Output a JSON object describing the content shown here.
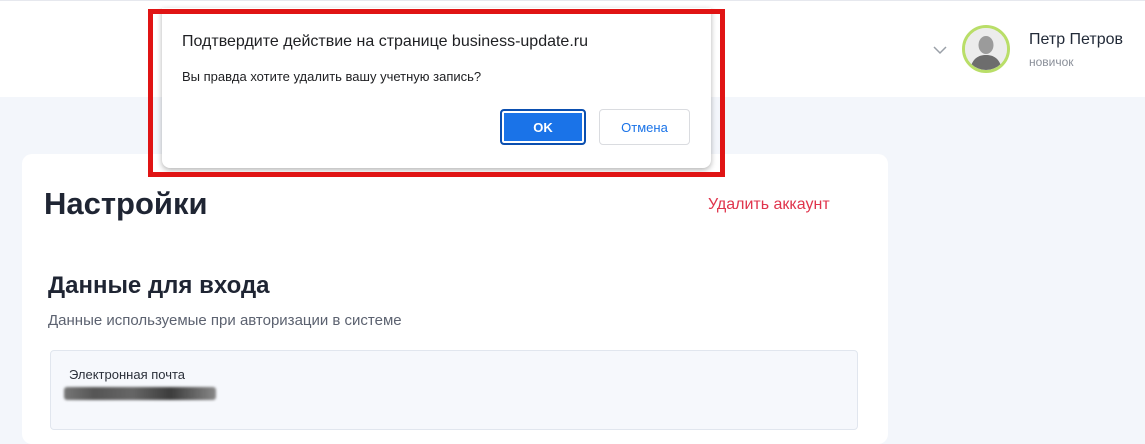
{
  "header": {
    "user": {
      "name": "Петр Петров",
      "role": "новичок"
    },
    "icons": {
      "menu": "chevron-down-icon",
      "avatar": "user-avatar-icon"
    }
  },
  "settings": {
    "title": "Настройки",
    "delete_account_link": "Удалить аккаунт",
    "login_section": {
      "title": "Данные для входа",
      "subtitle": "Данные используемые при авторизации в системе",
      "email_label": "Электронная почта",
      "email_value_redacted": true
    }
  },
  "confirm_dialog": {
    "title": "Подтвердите действие на странице business-update.ru",
    "message": "Вы правда хотите удалить вашу учетную запись?",
    "ok_label": "OK",
    "cancel_label": "Отмена"
  },
  "colors": {
    "accent": "#1a73e8",
    "danger": "#e0344c",
    "highlight": "#e01414",
    "avatar_ring": "#b9de68",
    "page_background": "#f3f6fb"
  }
}
